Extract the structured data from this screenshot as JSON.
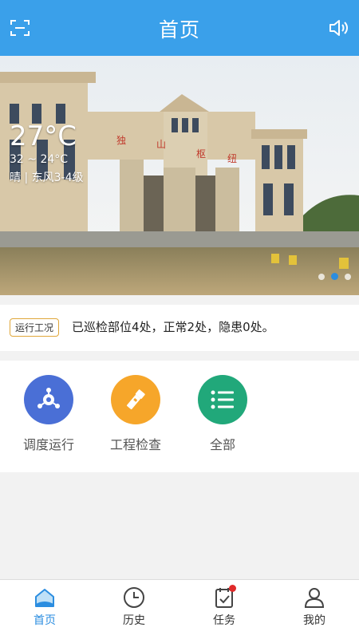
{
  "header": {
    "title": "首页",
    "scan_icon": "scan-icon",
    "speaker_icon": "speaker-icon"
  },
  "banner": {
    "weather": {
      "temp": "27°C",
      "range": "32 ~ 24°C",
      "condition": "晴 | 东风3-4级"
    },
    "slides": 3,
    "active_slide": 2
  },
  "status": {
    "tag": "运行工况",
    "text": "已巡检部位4处，正常2处，隐患0处。"
  },
  "grid": {
    "items": [
      {
        "label": "调度运行",
        "icon": "dispatch-icon",
        "color": "#4a6fd6"
      },
      {
        "label": "工程检查",
        "icon": "flashlight-icon",
        "color": "#f6a62a"
      },
      {
        "label": "全部",
        "icon": "list-icon",
        "color": "#21a87a"
      }
    ]
  },
  "tabbar": {
    "items": [
      {
        "label": "首页",
        "icon": "home-icon",
        "active": true
      },
      {
        "label": "历史",
        "icon": "clock-icon"
      },
      {
        "label": "任务",
        "icon": "task-icon",
        "badge": true
      },
      {
        "label": "我的",
        "icon": "user-icon"
      }
    ]
  }
}
